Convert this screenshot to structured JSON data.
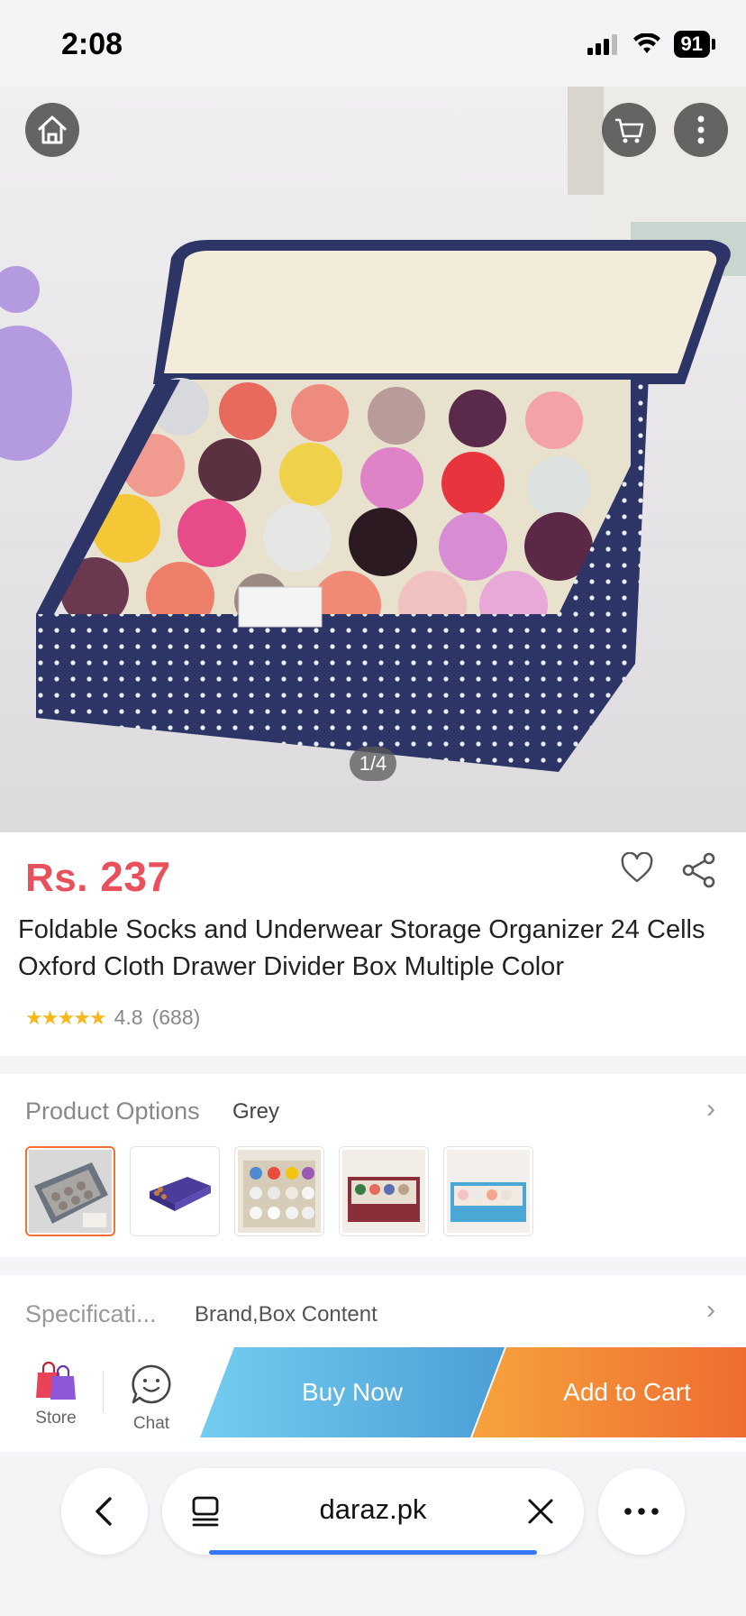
{
  "status_bar": {
    "time": "2:08",
    "battery": "91"
  },
  "gallery": {
    "counter": "1/4"
  },
  "product": {
    "price_currency": "Rs.",
    "price_value": "237",
    "title": "Foldable Socks and Underwear Storage Organizer 24 Cells Oxford Cloth Drawer Divider Box Multiple Color",
    "stars": "★★★★★",
    "rating": "4.8",
    "reviews": "(688)"
  },
  "options": {
    "label": "Product Options",
    "selected": "Grey",
    "chevron": "›",
    "thumbnails": [
      {
        "name": "grey"
      },
      {
        "name": "purple"
      },
      {
        "name": "beige"
      },
      {
        "name": "red"
      },
      {
        "name": "blue"
      }
    ]
  },
  "specifications": {
    "label": "Specificati...",
    "value": "Brand,Box Content",
    "chevron": "›"
  },
  "actions": {
    "store": "Store",
    "chat": "Chat",
    "buy_now": "Buy Now",
    "add_to_cart": "Add to Cart"
  },
  "browser": {
    "url": "daraz.pk"
  },
  "colors": {
    "price": "#e8515c",
    "buy_now": "#4c9ed6",
    "add_to_cart": "#ee6c2f",
    "selected_border": "#f36f35",
    "star": "#f6b81c",
    "load_progress": "#3478f6"
  }
}
